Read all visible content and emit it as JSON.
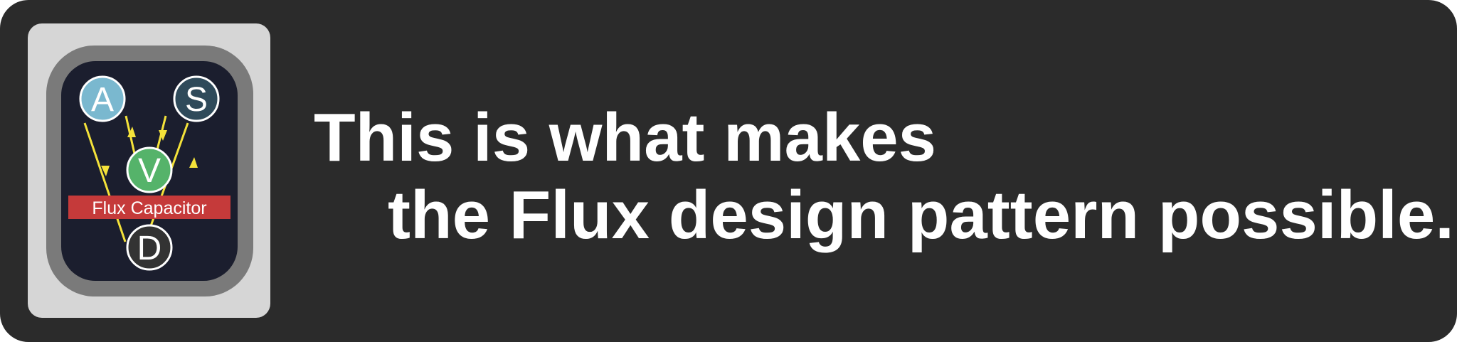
{
  "logo": {
    "nodes": [
      {
        "id": "action",
        "letter": "A",
        "fill": "#7ab8cf"
      },
      {
        "id": "store",
        "letter": "S",
        "fill": "#2f4a5a"
      },
      {
        "id": "view",
        "letter": "V",
        "fill": "#55b36a"
      },
      {
        "id": "dispatcher",
        "letter": "D",
        "fill": "#333333"
      }
    ],
    "label": "Flux Capacitor",
    "label_color": "#c53a3a",
    "arrow_color": "#f4e23a",
    "screen_color": "#1b1e2e",
    "frame_color": "#7a7a7a"
  },
  "headline": {
    "line1": "This is what makes",
    "line2": "the Flux design pattern possible."
  },
  "colors": {
    "banner_bg": "#2b2b2b",
    "panel_bg": "#d6d6d6",
    "text": "#ffffff"
  }
}
